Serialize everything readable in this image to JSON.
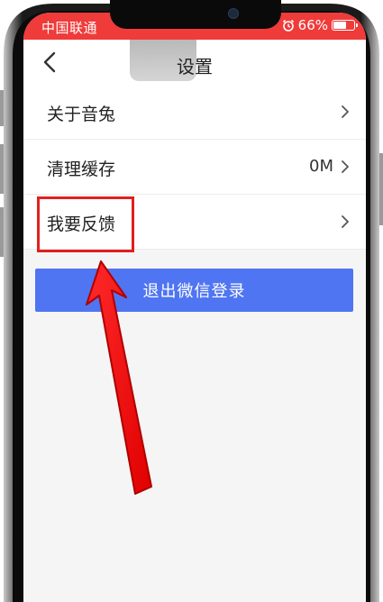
{
  "status_bar": {
    "carrier": "中国联通",
    "battery_percent": "66%",
    "battery_level": 0.66,
    "bg_color": "#ef3b3a"
  },
  "header": {
    "title": "设置",
    "back_icon": "chevron-left-icon"
  },
  "settings": {
    "items": [
      {
        "label": "关于音兔",
        "value": "",
        "icon": "chevron-right-icon"
      },
      {
        "label": "清理缓存",
        "value": "0M",
        "icon": "chevron-right-icon"
      },
      {
        "label": "我要反馈",
        "value": "",
        "icon": "chevron-right-icon"
      }
    ]
  },
  "logout": {
    "label": "退出微信登录",
    "color": "#4f75f2"
  },
  "annotation": {
    "highlight_color": "#e02020",
    "arrow_color": "#ff1a1a"
  }
}
